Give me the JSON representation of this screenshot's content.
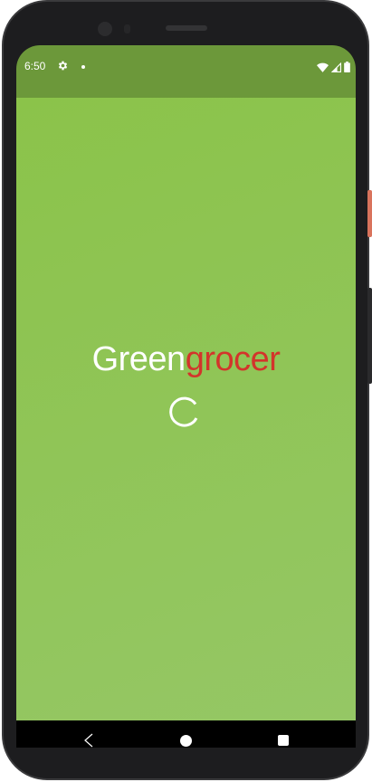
{
  "status_bar": {
    "time": "6:50",
    "icons": [
      "settings-gear-icon",
      "notification-dot-icon",
      "wifi-icon",
      "cell-signal-icon",
      "battery-icon"
    ],
    "background": "#6c983a"
  },
  "splash": {
    "logo_part1": "Green",
    "logo_part2": "grocer",
    "logo_part1_color": "#ffffff",
    "logo_part2_color": "#d3342b",
    "background": "#8bc34a",
    "loading_indicator": "spinner-icon"
  },
  "navigation_bar": {
    "buttons": [
      "back-icon",
      "home-icon",
      "recents-icon"
    ]
  }
}
